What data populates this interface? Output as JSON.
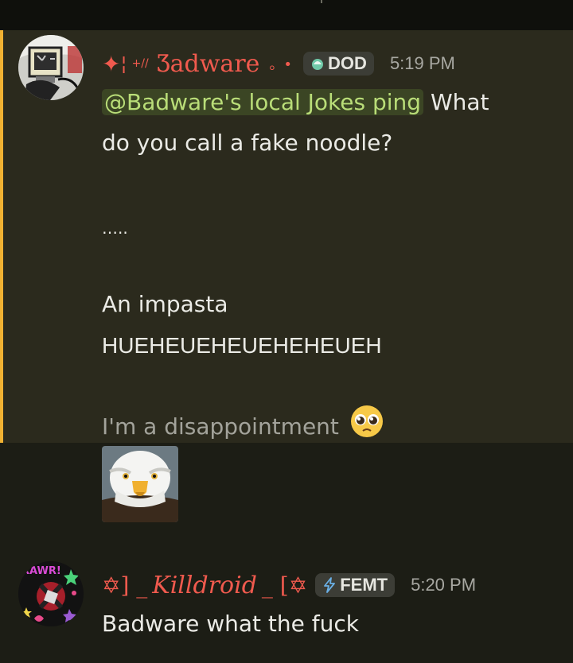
{
  "messages": [
    {
      "author": {
        "prefix_glyph": "✦",
        "prefix_mark": "¦",
        "prefix_small": "+//",
        "name": "Ʒadware",
        "suffix": "。•",
        "tag": "DOD",
        "tag_icon": "droplet-icon",
        "color": "#f05a4e"
      },
      "timestamp": "5:19 PM",
      "mention": "@Badware's local Jokes ping",
      "lines": [
        "What",
        "do you call a fake noodle?",
        "…..",
        "An impasta",
        "HUEHEUEHEUEHEHEUEH",
        "I'm a disappointment"
      ],
      "emoji": "pleading-face-icon",
      "attachment": "bald-eagle-image",
      "highlight_color": "#f0b132"
    },
    {
      "author": {
        "prefix": "✡] _",
        "name": "Killdroid",
        "suffix": "_ [✡",
        "tag": "FEMT",
        "tag_icon": "lightning-icon",
        "color": "#f05a4e"
      },
      "avatar_text": "RAWR!",
      "timestamp": "5:20 PM",
      "text": "Badware what the fuck"
    }
  ],
  "colors": {
    "mention_bg": "#3b4524",
    "mention_fg": "#b9dd78",
    "muted": "#a3a39b"
  }
}
